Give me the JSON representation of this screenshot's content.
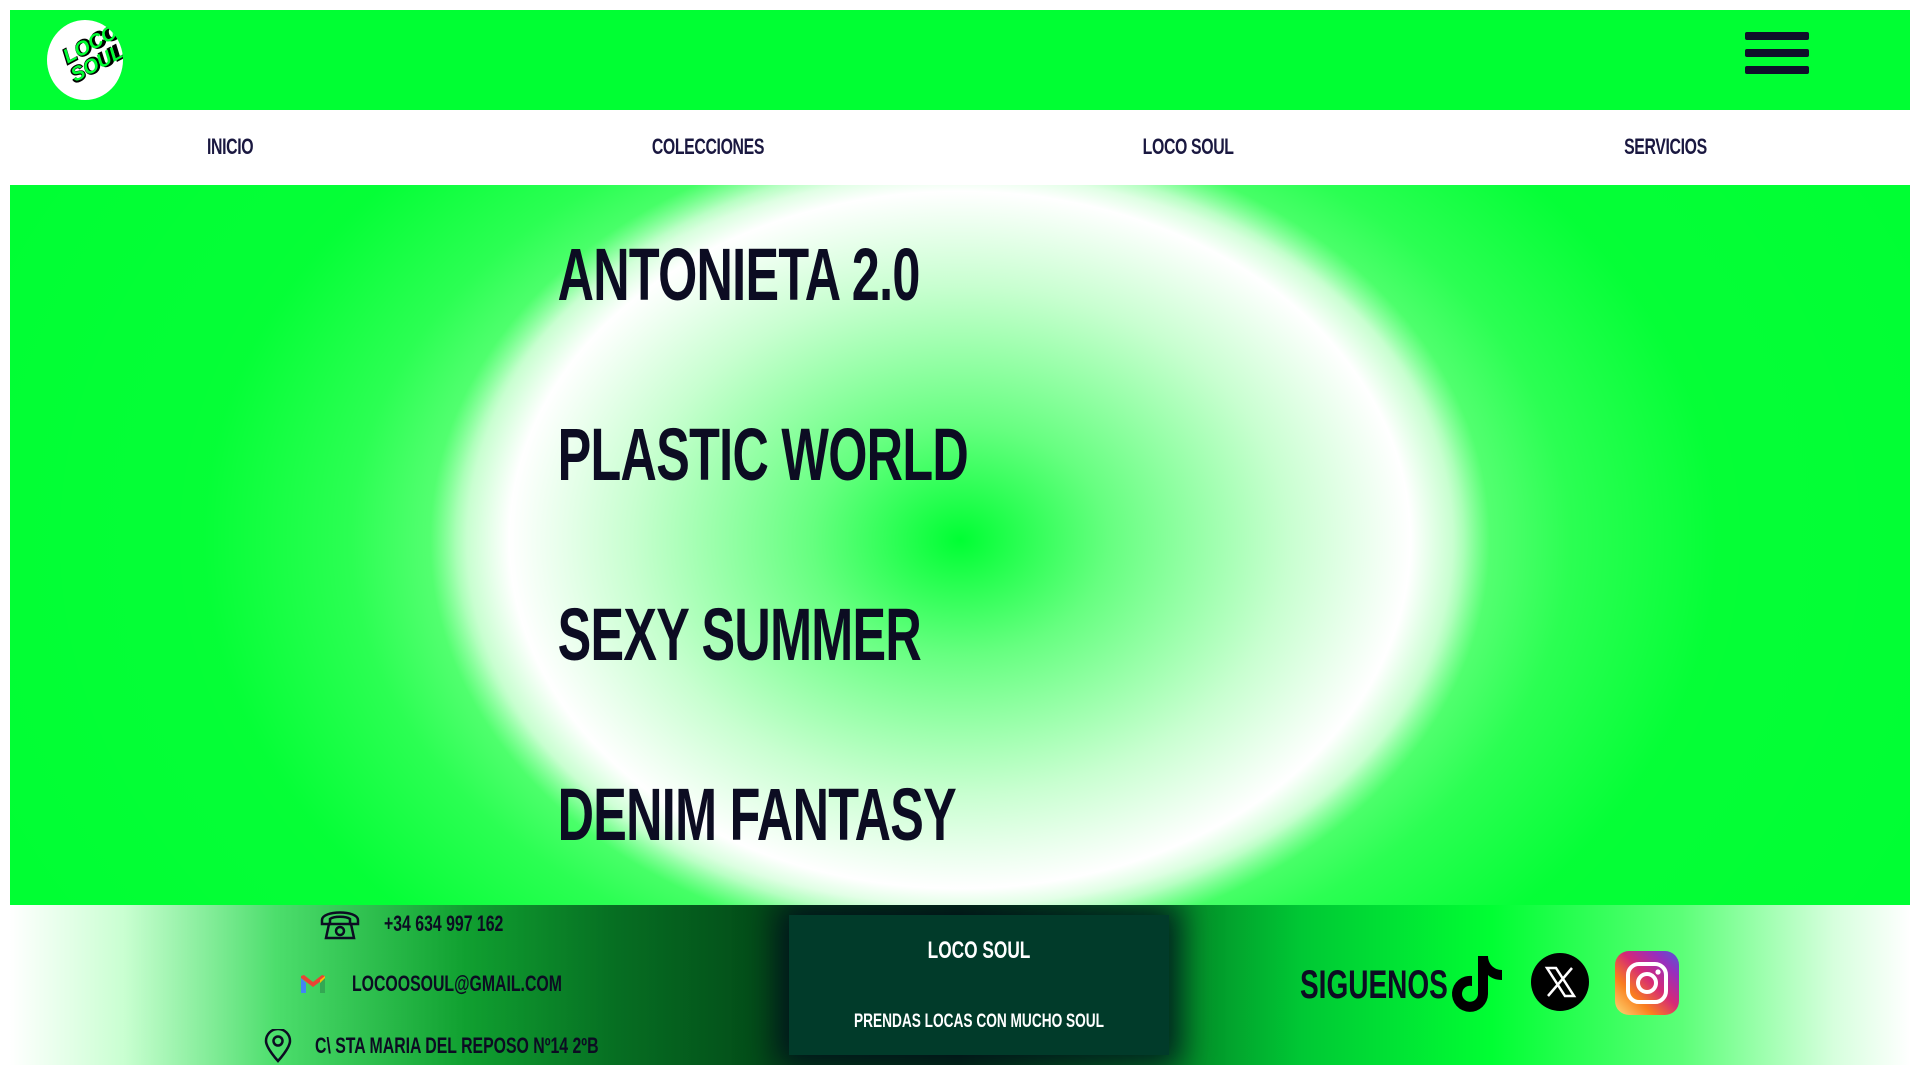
{
  "header": {
    "logo_text": "LOCO SOUL",
    "colors": {
      "primary_green": "#00ff33",
      "dark_navy": "#0f0f2a"
    }
  },
  "nav": {
    "items": [
      {
        "label": "INICIO"
      },
      {
        "label": "COLECCIONES"
      },
      {
        "label": "LOCO SOUL"
      },
      {
        "label": "SERVICIOS"
      }
    ]
  },
  "collections": [
    {
      "label": "ANTONIETA 2.0"
    },
    {
      "label": "PLASTIC WORLD"
    },
    {
      "label": "SEXY SUMMER"
    },
    {
      "label": "DENIM FANTASY"
    }
  ],
  "footer": {
    "phone": "+34 634 997 162",
    "email": "LOCOOSOUL@GMAIL.COM",
    "address": "C\\ STA MARIA DEL REPOSO Nº14 2ºB",
    "brand_title": "LOCO SOUL",
    "brand_tagline": "PRENDAS LOCAS CON MUCHO SOUL",
    "follow_label": "SIGUENOS",
    "social_icons": [
      "tiktok-icon",
      "x-icon",
      "instagram-icon"
    ]
  }
}
